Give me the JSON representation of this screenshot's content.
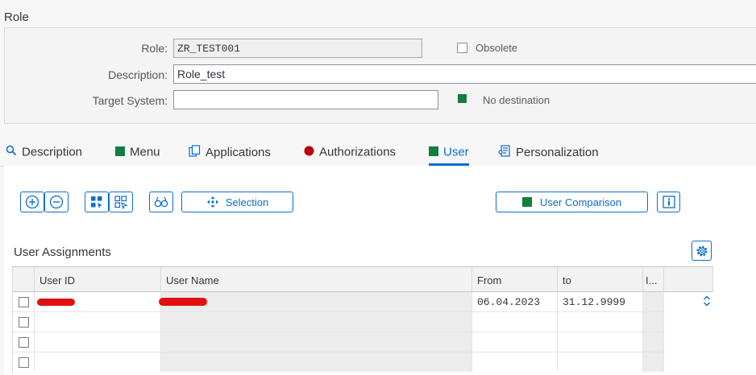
{
  "page": {
    "title": "Role"
  },
  "form": {
    "role_label": "Role:",
    "role_value": "ZR_TEST001",
    "obsolete_label": "Obsolete",
    "description_label": "Description:",
    "description_value": "Role_test",
    "target_label": "Target System:",
    "target_value": "",
    "destination_status": "No destination"
  },
  "tabs": [
    {
      "label": "Description",
      "icon": "magnifier-icon"
    },
    {
      "label": "Menu",
      "icon": "green-square-icon"
    },
    {
      "label": "Applications",
      "icon": "copy-icon"
    },
    {
      "label": "Authorizations",
      "icon": "red-circle-icon"
    },
    {
      "label": "User",
      "icon": "green-square-icon",
      "active": true
    },
    {
      "label": "Personalization",
      "icon": "personalization-icon"
    }
  ],
  "toolbar": {
    "selection_label": "Selection",
    "user_comparison_label": "User Comparison"
  },
  "assignments": {
    "title": "User Assignments",
    "columns": [
      "User ID",
      "User Name",
      "From",
      "to",
      "I..."
    ],
    "rows": [
      {
        "from": "06.04.2023",
        "to": "31.12.9999"
      },
      {
        "from": "",
        "to": ""
      },
      {
        "from": "",
        "to": ""
      },
      {
        "from": "",
        "to": ""
      }
    ]
  },
  "colors": {
    "accent": "#0a6ed1",
    "green": "#107e3e",
    "red": "#bb0000"
  }
}
